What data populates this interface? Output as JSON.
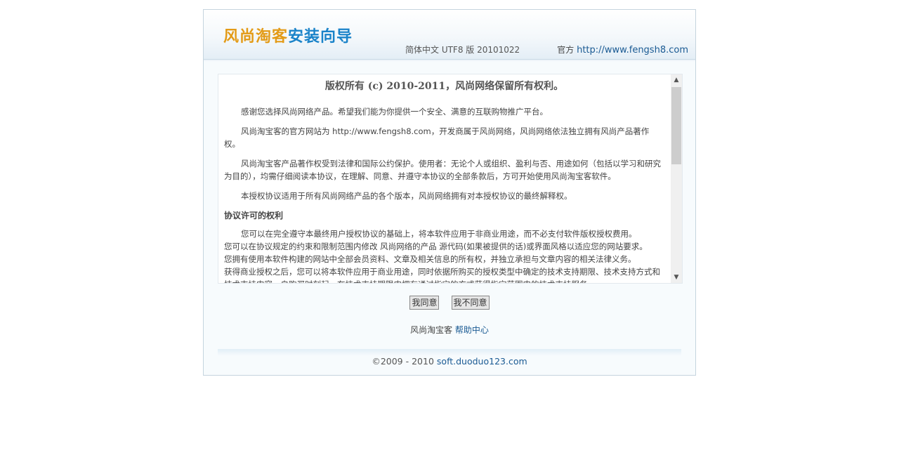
{
  "header": {
    "logo_part1": "风尚淘客",
    "logo_part2": "安装向导",
    "version": "简体中文 UTF8 版 20101022",
    "official_label": "官方",
    "official_url": "http://www.fengsh8.com"
  },
  "license": {
    "title": "版权所有 (c) 2010-2011，风尚网络保留所有权利。",
    "paragraphs": [
      "感谢您选择风尚网络产品。希望我们能为你提供一个安全、满意的互联购物推广平台。",
      "风尚淘宝客的官方网站为 http://www.fengsh8.com，开发商属于风尚网络，风尚网络依法独立拥有风尚产品著作权。",
      "风尚淘宝客产品著作权受到法律和国际公约保护。使用者：无论个人或组织、盈利与否、用途如何（包括以学习和研究为目的），均需仔细阅读本协议，在理解、同意、并遵守本协议的全部条款后，方可开始使用风尚淘宝客软件。",
      "本授权协议适用于所有风尚网络产品的各个版本，风尚网络拥有对本授权协议的最终解释权。"
    ],
    "section_heading": "协议许可的权利",
    "section_lines": [
      "您可以在完全遵守本最终用户授权协议的基础上，将本软件应用于非商业用途，而不必支付软件版权授权费用。",
      "您可以在协议规定的约束和限制范围内修改 风尚网络的产品 源代码(如果被提供的话)或界面风格以适应您的网站要求。",
      "您拥有使用本软件构建的网站中全部会员资料、文章及相关信息的所有权，并独立承担与文章内容的相关法律义务。",
      "获得商业授权之后，您可以将本软件应用于商业用途，同时依据所购买的授权类型中确定的技术支持期限、技术支持方式和技术支持内容，自购买时刻起，在技术支持期限内拥有通过指定的方式获得指定范围内的技术支持服务。"
    ],
    "scroll_up": "▲",
    "scroll_down": "▼"
  },
  "buttons": {
    "agree": "我同意",
    "disagree": "我不同意"
  },
  "help": {
    "prefix": "风尚淘宝客",
    "link": "帮助中心"
  },
  "footer": {
    "copyright": "©2009 - 2010",
    "link": "soft.duoduo123.com"
  }
}
